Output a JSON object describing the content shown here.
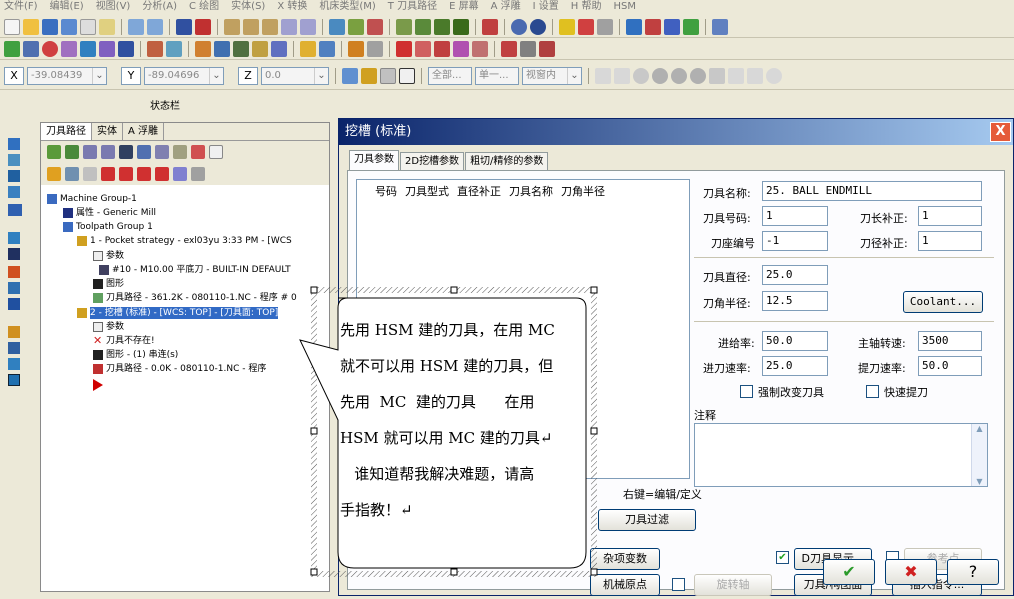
{
  "menubar": {
    "items": [
      "文件(F)",
      "编辑(E)",
      "视图(V)",
      "分析(A)",
      "C 绘图",
      "实体(S)",
      "X 转换",
      "机床类型(M)",
      "T 刀具路径",
      "E 屏幕",
      "A 浮雕",
      "I 设置",
      "H 帮助",
      "HSM"
    ]
  },
  "coords": {
    "x_label": "X",
    "x_value": "-39.08439",
    "y_label": "Y",
    "y_value": "-89.04696",
    "z_label": "Z",
    "z_value": "0.0",
    "all_label": "全部...",
    "single_label": "单一...",
    "view_label": "视窗内"
  },
  "statusbar_title": "状态栏",
  "tree_panel": {
    "tabs": [
      "刀具路径",
      "实体",
      "A 浮雕"
    ],
    "rows": [
      "Machine Group-1",
      "属性 - Generic Mill",
      "Toolpath Group 1",
      "1 - Pocket strategy - exl03yu 3:33 PM - [WCS",
      "参数",
      "#10 - M10.00 平底刀 - BUILT-IN DEFAULT",
      "图形",
      "刀具路径 - 361.2K - 080110-1.NC - 程序 # 0",
      "2 - 挖槽 (标准) - [WCS: TOP] - [刀具面: TOP]",
      "参数",
      "刀具不存在!",
      "图形 - (1) 串连(s)",
      "刀具路径 - 0.0K - 080110-1.NC - 程序"
    ]
  },
  "dialog": {
    "title": "挖槽 (标准)",
    "close_label": "X",
    "tabs": [
      "刀具参数",
      "2D挖槽参数",
      "粗切/精修的参数"
    ],
    "list_columns": [
      "号码",
      "刀具型式",
      "直径补正",
      "刀具名称",
      "刀角半径"
    ],
    "tool_name_label": "刀具名称:",
    "tool_name_value": "25. BALL ENDMILL",
    "tool_number_label": "刀具号码:",
    "tool_number_value": "1",
    "length_offset_label": "刀长补正:",
    "length_offset_value": "1",
    "holder_number_label": "刀座编号",
    "holder_number_value": "-1",
    "dia_offset_label": "刀径补正:",
    "dia_offset_value": "1",
    "diameter_label": "刀具直径:",
    "diameter_value": "25.0",
    "corner_radius_label": "刀角半径:",
    "corner_radius_value": "12.5",
    "coolant_label": "Coolant...",
    "feed_label": "进给率:",
    "feed_value": "50.0",
    "spindle_label": "主轴转速:",
    "spindle_value": "3500",
    "plunge_label": "进刀速率:",
    "plunge_value": "25.0",
    "retract_label": "提刀速率:",
    "retract_value": "50.0",
    "force_tool_change_label": "强制改变刀具",
    "rapid_retract_label": "快速提刀",
    "comment_label": "注释",
    "hint_text": "右键=编辑/定义",
    "tool_filter_label": "刀具过滤",
    "misc_vars_label": "杂项变数",
    "machine_origin_label": "机械原点",
    "rotary_axis_label": "旋转轴",
    "tool_display_label": "D刀具显示...",
    "ref_point_label": "参考点",
    "tool_plane_label": "刀具/构图面",
    "insert_cmd_label": "插入指令...",
    "ok_glyph": "✔",
    "cancel_glyph": "✖",
    "help_glyph": "?"
  },
  "callout": {
    "lines": [
      "先用 HSM 建的刀具，在用 MC",
      "就不可以用 HSM 建的刀具，但",
      "先用  MC  建的刀具      在用",
      "HSM 就可以用 MC 建的刀具↵",
      "   谁知道帮我解决难题，请高",
      "手指教！↵"
    ]
  }
}
